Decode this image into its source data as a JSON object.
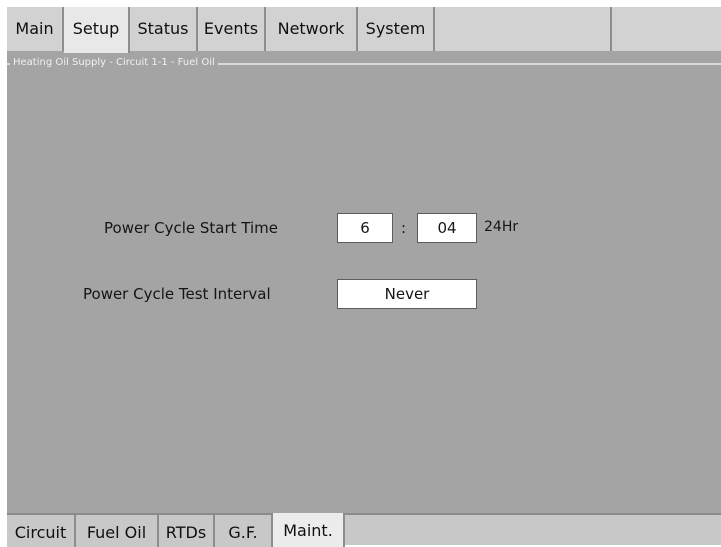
{
  "top_tabs": [
    {
      "label": "Main"
    },
    {
      "label": "Setup",
      "active": true
    },
    {
      "label": "Status"
    },
    {
      "label": "Events"
    },
    {
      "label": "Network"
    },
    {
      "label": "System"
    },
    {
      "label": ""
    },
    {
      "label": ""
    }
  ],
  "frame": {
    "title": "Heating Oil Supply - Circuit 1-1 - Fuel Oil"
  },
  "power_cycle": {
    "start_time_label": "Power Cycle Start Time",
    "hour": "6",
    "separator": ":",
    "minute": "04",
    "unit": "24Hr",
    "test_interval_label": "Power Cycle Test Interval",
    "test_interval_value": "Never"
  },
  "bottom_tabs": [
    {
      "label": "Circuit"
    },
    {
      "label": "Fuel Oil"
    },
    {
      "label": "RTDs"
    },
    {
      "label": "G.F."
    },
    {
      "label": "Maint.",
      "active": true
    }
  ],
  "colors": {
    "panel_background": "#a4a4a4",
    "tab_background": "#d2d2d2",
    "field_background": "#ffffff"
  }
}
